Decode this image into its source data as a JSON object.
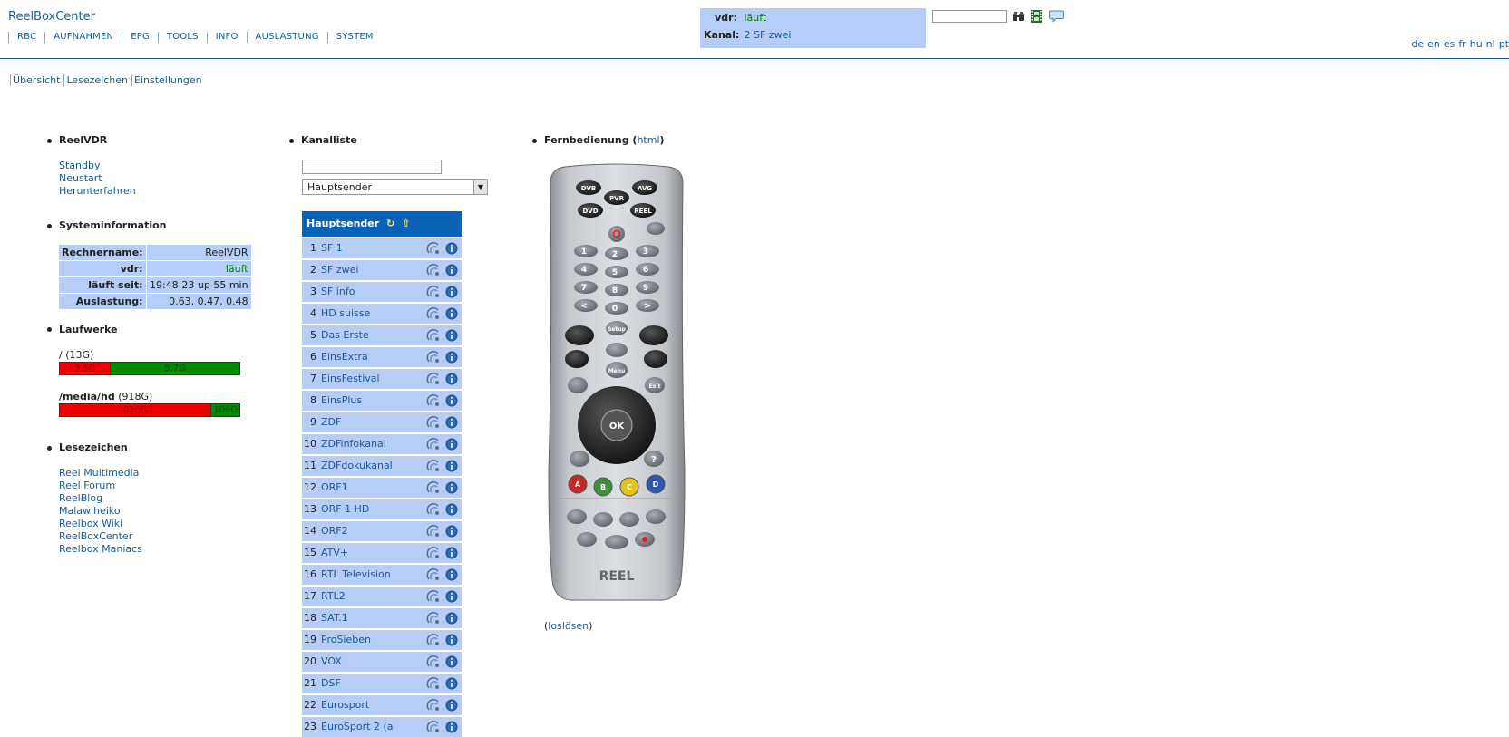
{
  "header": {
    "brand": "ReelBoxCenter",
    "nav": [
      "RBC",
      "AUFNAHMEN",
      "EPG",
      "TOOLS",
      "INFO",
      "AUSLASTUNG",
      "SYSTEM"
    ],
    "status": {
      "vdr_label": "vdr:",
      "vdr_value": "läuft",
      "kanal_label": "Kanal:",
      "kanal_value": "2 SF zwei"
    },
    "languages": [
      "de",
      "en",
      "es",
      "fr",
      "hu",
      "nl",
      "pt"
    ]
  },
  "subnav": [
    "Übersicht",
    "Lesezeichen",
    "Einstellungen"
  ],
  "reelvdr": {
    "title": "ReelVDR",
    "links": [
      "Standby",
      "Neustart",
      "Herunterfahren"
    ]
  },
  "sysinfo": {
    "title": "Systeminformation",
    "rows": [
      {
        "k": "Rechnername:",
        "v": "ReelVDR"
      },
      {
        "k": "vdr:",
        "v": "läuft"
      },
      {
        "k": "läuft seit:",
        "v": "19:48:23 up 55 min"
      },
      {
        "k": "Auslastung:",
        "v": "0.63, 0.47, 0.48"
      }
    ]
  },
  "drives": {
    "title": "Laufwerke",
    "items": [
      {
        "path": "/",
        "size": "(13G)",
        "used": "3.5G",
        "free": "9.7G",
        "used_fraction": 0.28
      },
      {
        "path": "/media/hd",
        "size": "(918G)",
        "used": "810G",
        "free": "109G",
        "used_fraction": 0.84
      }
    ]
  },
  "bookmarks": {
    "title": "Lesezeichen",
    "links": [
      "Reel Multimedia",
      "Reel Forum",
      "ReelBlog",
      "Malawiheiko",
      "Reelbox Wiki",
      "ReelBoxCenter",
      "Reelbox Maniacs"
    ]
  },
  "channels": {
    "title": "Kanalliste",
    "select_value": "Hauptsender",
    "list_header": "Hauptsender",
    "items": [
      {
        "n": "1",
        "name": "SF 1"
      },
      {
        "n": "2",
        "name": "SF zwei"
      },
      {
        "n": "3",
        "name": "SF info"
      },
      {
        "n": "4",
        "name": "HD suisse"
      },
      {
        "n": "5",
        "name": "Das Erste"
      },
      {
        "n": "6",
        "name": "EinsExtra"
      },
      {
        "n": "7",
        "name": "EinsFestival"
      },
      {
        "n": "8",
        "name": "EinsPlus"
      },
      {
        "n": "9",
        "name": "ZDF"
      },
      {
        "n": "10",
        "name": "ZDFinfokanal"
      },
      {
        "n": "11",
        "name": "ZDFdokukanal"
      },
      {
        "n": "12",
        "name": "ORF1"
      },
      {
        "n": "13",
        "name": "ORF 1 HD"
      },
      {
        "n": "14",
        "name": "ORF2"
      },
      {
        "n": "15",
        "name": "ATV+"
      },
      {
        "n": "16",
        "name": "RTL Television"
      },
      {
        "n": "17",
        "name": "RTL2"
      },
      {
        "n": "18",
        "name": "SAT.1"
      },
      {
        "n": "19",
        "name": "ProSieben"
      },
      {
        "n": "20",
        "name": "VOX"
      },
      {
        "n": "21",
        "name": "DSF"
      },
      {
        "n": "22",
        "name": "Eurosport"
      },
      {
        "n": "23",
        "name": "EuroSport 2 (a"
      }
    ]
  },
  "remote": {
    "title_pre": "Fernbedienung (",
    "title_link": "html",
    "title_post": ")",
    "detach_pre": "(",
    "detach_link": "loslösen",
    "detach_post": ")",
    "buttons": {
      "dvb": "DVB",
      "pvr": "PVR",
      "avg": "AVG",
      "dvd": "DVD",
      "reel": "REEL",
      "setup": "Setup",
      "menu": "Menu",
      "exit": "Exit",
      "ok": "OK",
      "help": "?",
      "a": "A",
      "b": "B",
      "c": "C",
      "d": "D",
      "digits": [
        "1",
        "2",
        "3",
        "4",
        "5",
        "6",
        "7",
        "8",
        "9",
        "<",
        "0",
        ">"
      ],
      "brand": "REEL"
    }
  }
}
